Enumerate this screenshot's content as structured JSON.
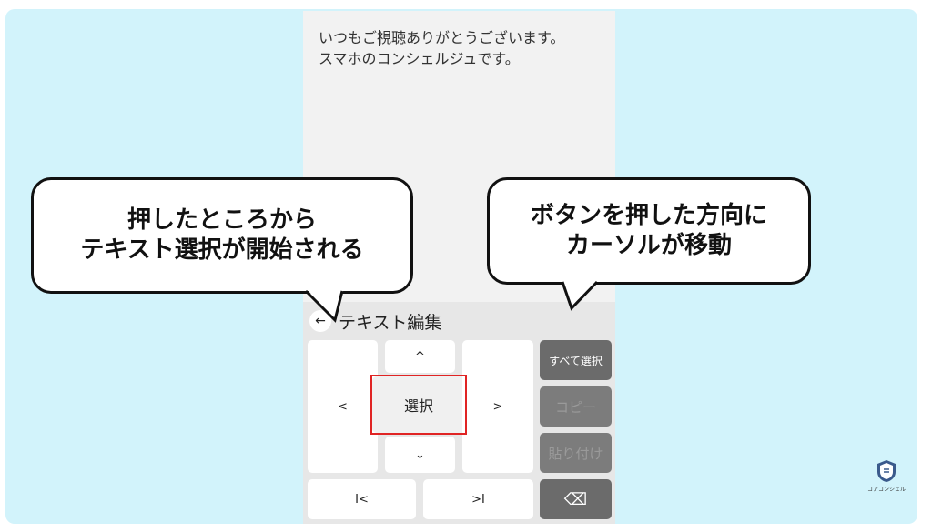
{
  "editor": {
    "text": "いつもご視聴ありがとうございます。\nスマホのコンシェルジュです。"
  },
  "keyboard": {
    "title": "テキスト編集",
    "back_icon": "←",
    "up_arrow": "^",
    "down_arrow": "⌄",
    "left_arrow": "<",
    "right_arrow": ">",
    "select_label": "選択",
    "select_all_label": "すべて選択",
    "copy_label": "コピー",
    "paste_label": "貼り付け",
    "home_label": "I<",
    "end_label": ">I",
    "delete_icon": "⌫"
  },
  "callouts": {
    "left": {
      "line1": "押したところから",
      "line2": "テキスト選択が開始される"
    },
    "right": {
      "line1": "ボタンを押した方向に",
      "line2": "カーソルが移動"
    }
  },
  "logo": {
    "text": "コアコンシェル"
  }
}
